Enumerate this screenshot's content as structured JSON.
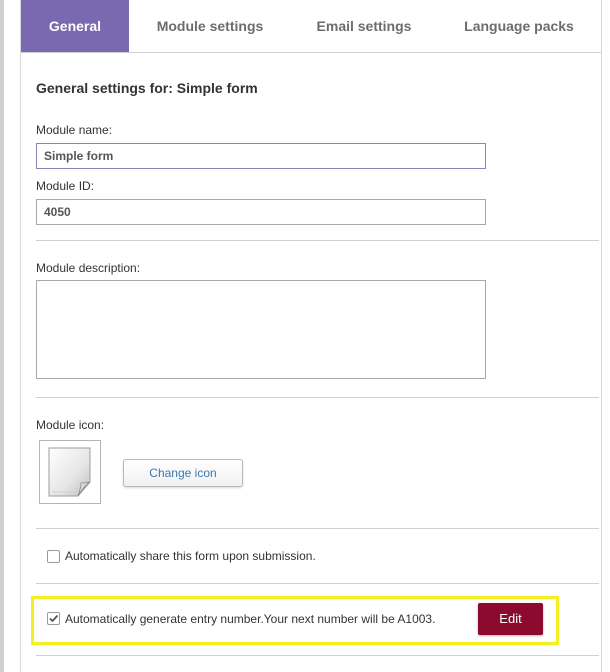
{
  "tabs": [
    {
      "label": "General",
      "active": true
    },
    {
      "label": "Module settings",
      "active": false
    },
    {
      "label": "Email settings",
      "active": false
    },
    {
      "label": "Language packs",
      "active": false
    }
  ],
  "general": {
    "heading": "General settings for: Simple form",
    "module_name_label": "Module name:",
    "module_name_value": "Simple form",
    "module_id_label": "Module ID:",
    "module_id_value": "4050",
    "description_label": "Module description:",
    "description_value": "",
    "icon_label": "Module icon:",
    "change_icon_label": "Change icon"
  },
  "options": {
    "share_label": "Automatically share this form upon submission.",
    "share_checked": false,
    "entry_number_label": "Automatically generate entry number.Your next number will be A1003.",
    "entry_number_checked": true,
    "edit_label": "Edit"
  },
  "colors": {
    "accent": "#7a68b0",
    "edit_button": "#8b0a2e",
    "highlight": "#f5ef1e",
    "link": "#3a78b5"
  }
}
